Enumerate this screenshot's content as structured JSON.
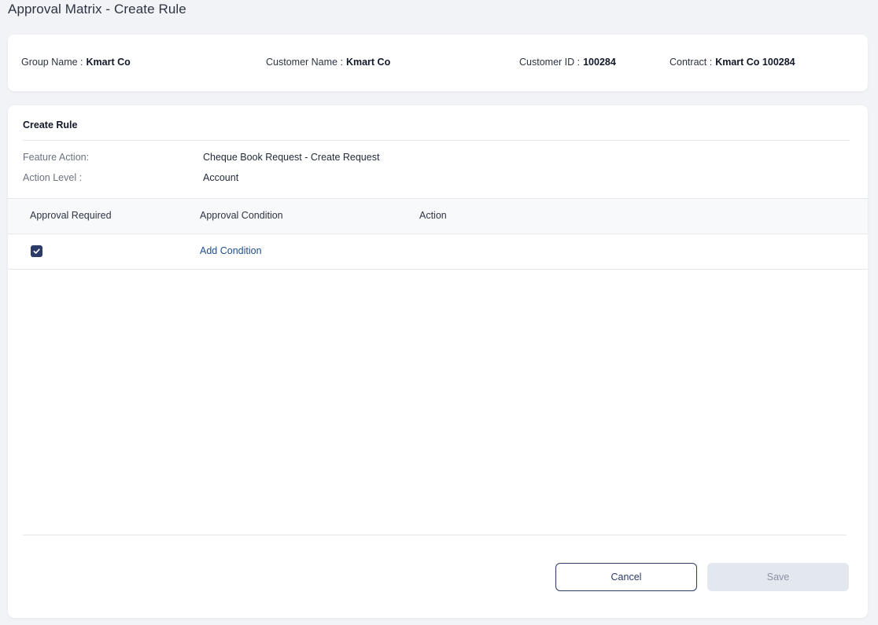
{
  "page": {
    "title": "Approval Matrix - Create Rule"
  },
  "info": {
    "group_name_label": "Group Name :",
    "group_name_value": "Kmart Co",
    "customer_name_label": "Customer Name :",
    "customer_name_value": "Kmart Co",
    "customer_id_label": "Customer ID :",
    "customer_id_value": "100284",
    "contract_label": "Contract :",
    "contract_value": "Kmart Co 100284"
  },
  "rule": {
    "title": "Create Rule",
    "feature_action_label": "Feature Action:",
    "feature_action_value": "Cheque Book Request - Create Request",
    "action_level_label": "Action Level :",
    "action_level_value": "Account"
  },
  "table": {
    "headers": [
      "Approval Required",
      "Approval Condition",
      "Action"
    ],
    "rows": [
      {
        "approval_required": true,
        "approval_condition_link": "Add Condition",
        "action": ""
      }
    ]
  },
  "footer": {
    "cancel_label": "Cancel",
    "save_label": "Save"
  },
  "colors": {
    "accent": "#2b3a67",
    "link": "#1d4f91",
    "disabled_bg": "#e3e8ef",
    "page_bg": "#f1f3f6"
  },
  "icons": {
    "checkbox": "check-icon"
  }
}
